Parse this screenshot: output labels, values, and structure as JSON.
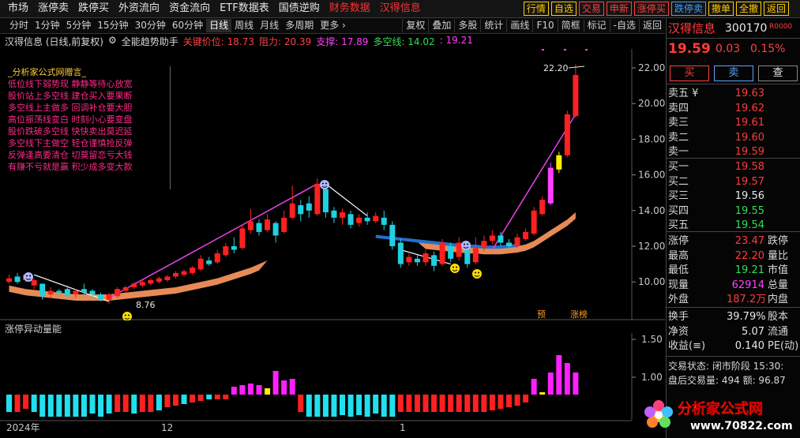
{
  "topmenu": {
    "items": [
      "市场",
      "涨停卖",
      "跌停买",
      "外资流向",
      "资金流向",
      "ETF数据表",
      "国债逆购"
    ],
    "highlight": [
      "财务数据",
      "汉得信息"
    ]
  },
  "topbuttons": [
    {
      "label": "行情",
      "color": "#ffcc00"
    },
    {
      "label": "自选",
      "color": "#ffcc00"
    },
    {
      "label": "交易",
      "color": "#ff4040"
    },
    {
      "label": "申新",
      "color": "#ff4040"
    },
    {
      "label": "涨停买",
      "color": "#ff4040"
    },
    {
      "label": "跌停卖",
      "color": "#40a0ff"
    },
    {
      "label": "撤单",
      "color": "#ffcc00"
    },
    {
      "label": "全撤",
      "color": "#ffcc00"
    },
    {
      "label": "返回",
      "color": "#ffcc00"
    }
  ],
  "periods": [
    "分时",
    "1分钟",
    "5分钟",
    "15分钟",
    "30分钟",
    "60分钟",
    "日线",
    "周线",
    "月线",
    "多周期",
    "更多 ›"
  ],
  "active_period": "日线",
  "tools": [
    "复权",
    "叠加",
    "多股",
    "统计",
    "画线",
    "F10",
    "简框",
    "标记",
    "-自选",
    "返回"
  ],
  "indicator": {
    "name": "汉得信息 (日线,前复权)",
    "assist": "全能趋势助手",
    "key_price": "关键价位: 18.73",
    "resistance": "阻力: 20.39",
    "support": "支撑: 17.89",
    "bull_line": "多空线: 14.02",
    "extra": ": 19.21"
  },
  "advice": {
    "title": "_分析家公式网赠言_",
    "lines": [
      "低位线下弱势现  静静等待心放宽",
      "股价站上多空线  建仓买入要果断",
      "多空线上主做多  回调补仓要大胆",
      "高位振荡线变白  时刻小心要变盘",
      "股价跌破多空线  快快卖出莫迟延",
      "多空线下主做空  轻仓谨慎抢反弹",
      "反弹逢高要清仓  切莫留恋亏大钱",
      "有赚不亏就是赢  积少成多变大款"
    ]
  },
  "y_axis": [
    "22.00",
    "20.00",
    "18.00",
    "16.00",
    "14.00",
    "12.00",
    "10.00"
  ],
  "annotations": {
    "high": "22.20",
    "low": "8.76",
    "tag_yu": "预",
    "tag_zb": "涨榜"
  },
  "sub_indicator": {
    "name": "涨停异动量能",
    "y_axis": [
      "1.50",
      "1.00"
    ]
  },
  "x_labels": [
    "2024年",
    "12",
    "1"
  ],
  "quote": {
    "name": "汉得信息",
    "code": "300170",
    "badge": "R0000",
    "price": "19.59",
    "change": "0.03",
    "pct": "0.15%",
    "buy": "买",
    "sell": "卖",
    "query": "查",
    "asks": [
      {
        "label": "卖五 ¥",
        "price": "19.63"
      },
      {
        "label": "卖四",
        "price": "19.62"
      },
      {
        "label": "卖三",
        "price": "19.61"
      },
      {
        "label": "卖二",
        "price": "19.60"
      },
      {
        "label": "卖一",
        "price": "19.59"
      }
    ],
    "bids": [
      {
        "label": "买一",
        "price": "19.58",
        "color": "red"
      },
      {
        "label": "买二",
        "price": "19.57",
        "color": "red"
      },
      {
        "label": "买三",
        "price": "19.56",
        "color": "white"
      },
      {
        "label": "买四",
        "price": "19.55",
        "color": "green"
      },
      {
        "label": "买五",
        "price": "19.54",
        "color": "green"
      }
    ],
    "stats": [
      {
        "l": "涨停",
        "v": "23.47",
        "c": "red",
        "r": "跌停"
      },
      {
        "l": "最高",
        "v": "22.20",
        "c": "red",
        "r": "量比"
      },
      {
        "l": "最低",
        "v": "19.21",
        "c": "green",
        "r": "市值"
      },
      {
        "l": "现量",
        "v": "62914",
        "c": "pink",
        "r": "总量"
      },
      {
        "l": "外盘",
        "v": "187.2万",
        "c": "red",
        "r": "内盘"
      }
    ],
    "stats2": [
      {
        "l": "换手",
        "v": "39.79%",
        "c": "white",
        "r": "股本"
      },
      {
        "l": "净资",
        "v": "5.07",
        "c": "white",
        "r": "流通"
      },
      {
        "l": "收益(≡)",
        "v": "0.140",
        "c": "white",
        "r": "PE(动)"
      }
    ],
    "trade_state": "交易状态: 闭市阶段 15:30:",
    "after_hours": "盘后交易量: 494  额: 96.87"
  },
  "watermark": {
    "site": "分析家公式网",
    "url": "www.70822.com"
  },
  "colors": {
    "up": "#ff2020",
    "down": "#20d0e0",
    "trend_up": "#e040e0",
    "trend_down": "#2070d0",
    "band": "#ff9a60"
  }
}
